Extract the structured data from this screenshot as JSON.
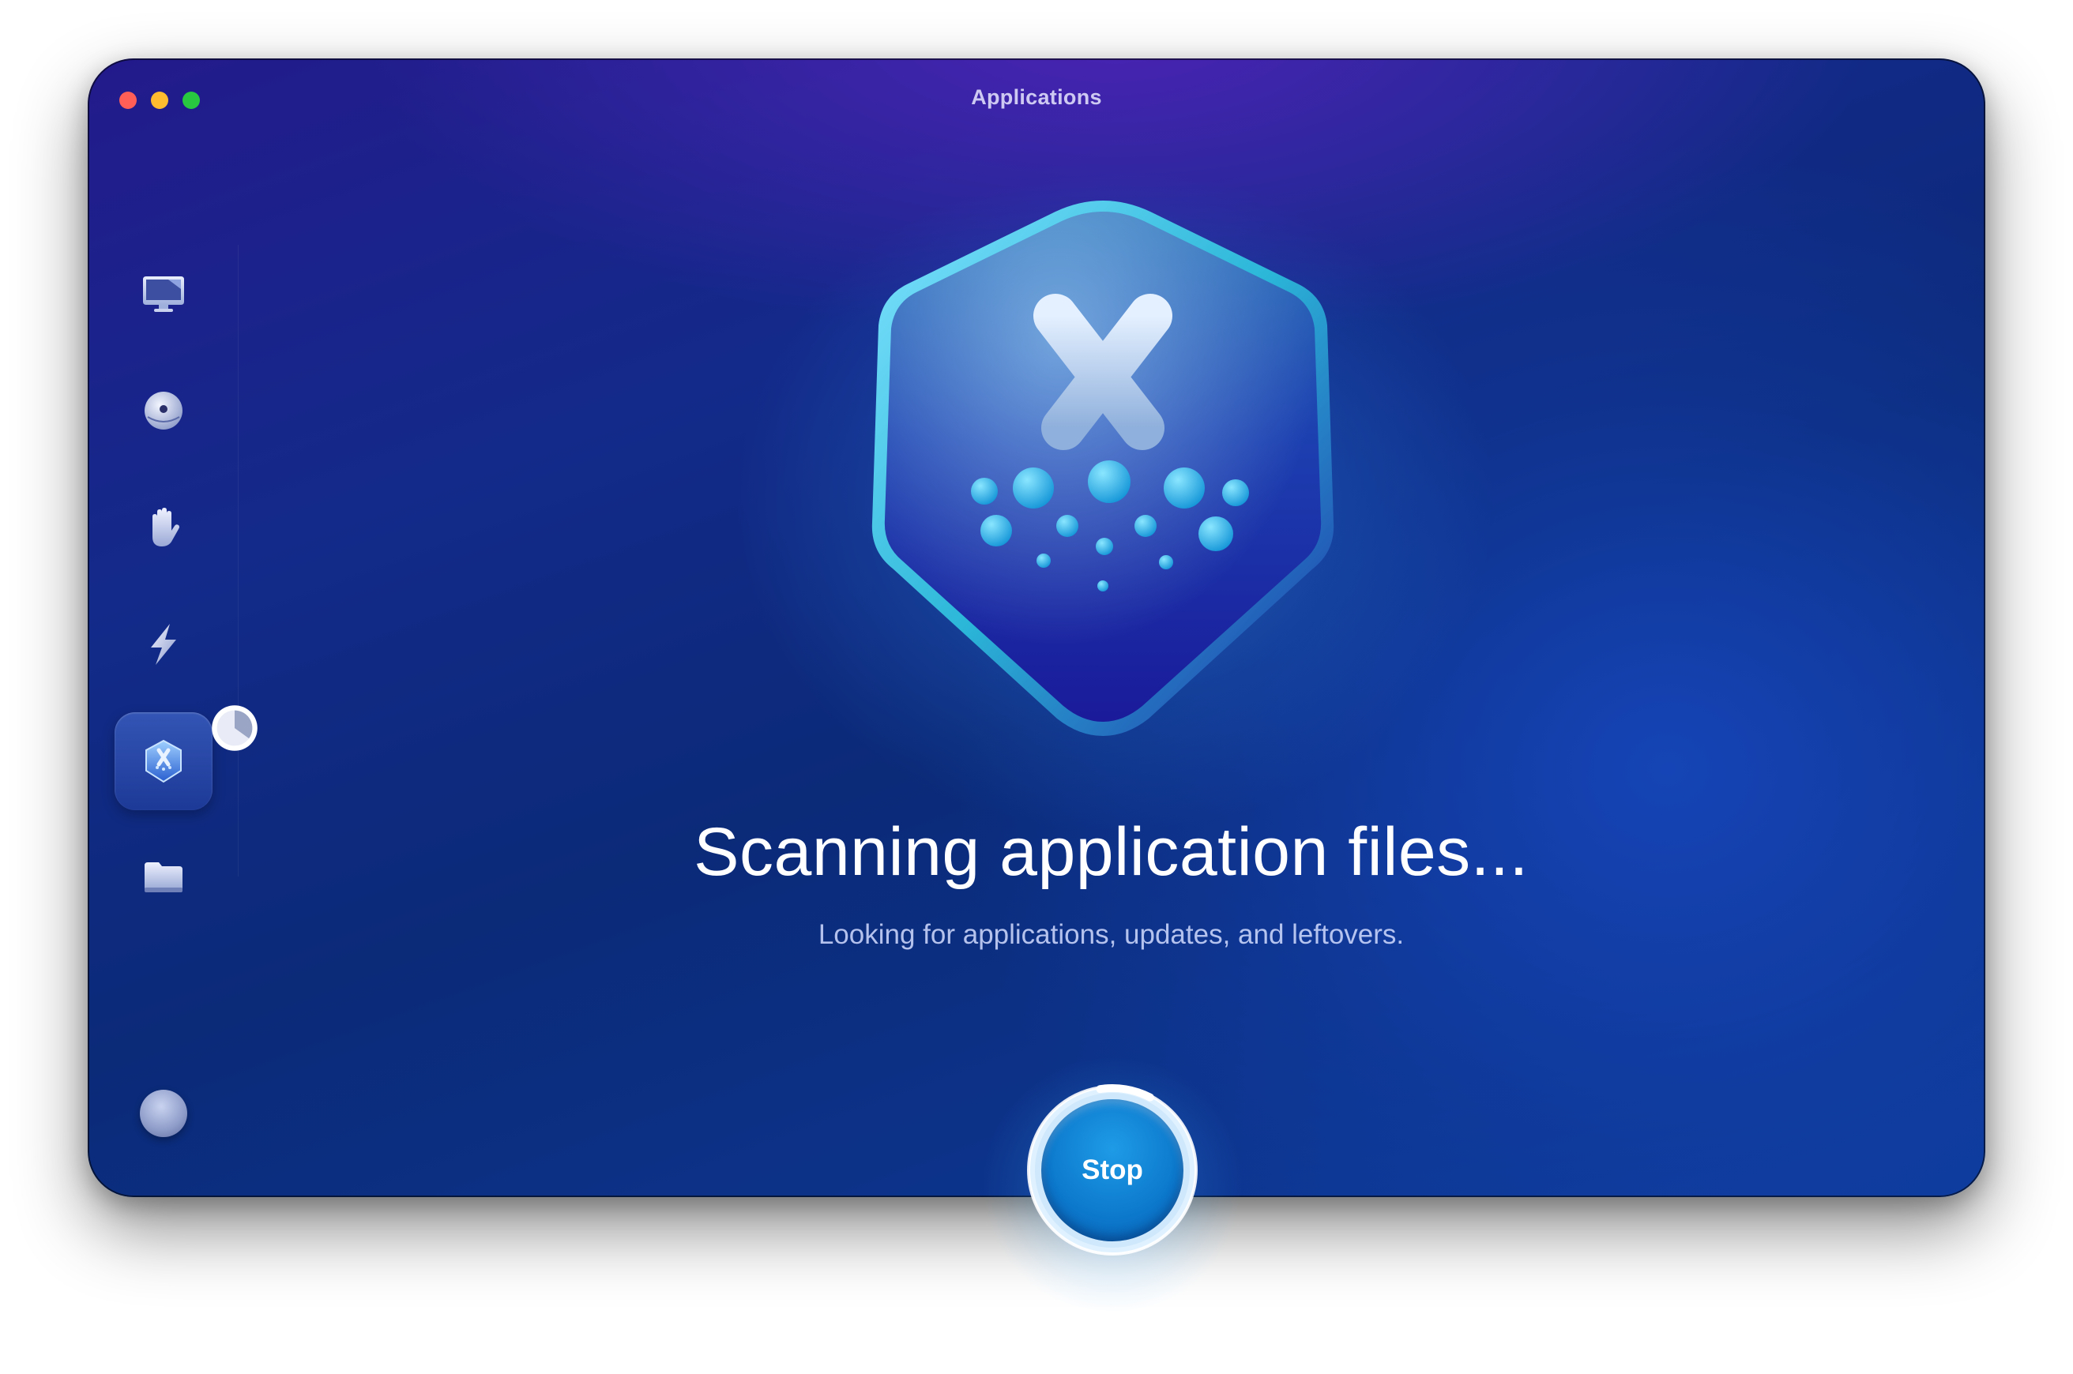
{
  "window": {
    "title": "Applications"
  },
  "sidebar": {
    "items": [
      {
        "name": "smart-care",
        "icon": "monitor-icon",
        "active": false
      },
      {
        "name": "cleanup",
        "icon": "disc-icon",
        "active": false
      },
      {
        "name": "protection",
        "icon": "hand-icon",
        "active": false
      },
      {
        "name": "performance",
        "icon": "lightning-icon",
        "active": false
      },
      {
        "name": "applications",
        "icon": "applications-hex-icon",
        "active": true,
        "progress": 0.35
      },
      {
        "name": "my-clutter",
        "icon": "folder-icon",
        "active": false
      }
    ],
    "assistant_icon": "assistant-icon"
  },
  "main": {
    "headline": "Scanning application files...",
    "subtitle": "Looking for applications, updates, and leftovers."
  },
  "stop_button": {
    "label": "Stop",
    "progress": 0.1
  },
  "colors": {
    "accent": "#0c78cc",
    "close": "#ff5f57",
    "minimize": "#febc2e",
    "zoom": "#28c840"
  }
}
